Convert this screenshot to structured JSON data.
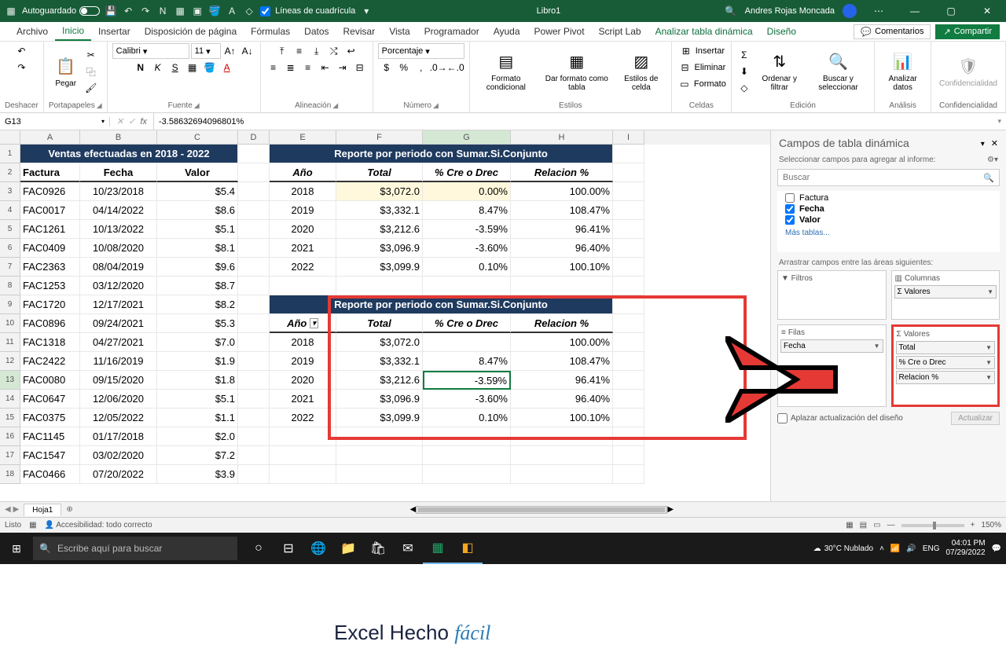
{
  "title": {
    "autosave": "Autoguardado",
    "gridlines": "Líneas de cuadrícula",
    "book": "Libro1",
    "user": "Andres Rojas Moncada"
  },
  "tabs": [
    "Archivo",
    "Inicio",
    "Insertar",
    "Disposición de página",
    "Fórmulas",
    "Datos",
    "Revisar",
    "Vista",
    "Programador",
    "Ayuda",
    "Power Pivot",
    "Script Lab",
    "Analizar tabla dinámica",
    "Diseño"
  ],
  "ribbon": {
    "comments": "Comentarios",
    "share": "Compartir",
    "undo": "Deshacer",
    "clipboard": "Portapapeles",
    "paste": "Pegar",
    "font": "Fuente",
    "font_name": "Calibri",
    "font_size": "11",
    "alignment": "Alineación",
    "number": "Número",
    "number_fmt": "Porcentaje",
    "styles": "Estilos",
    "cond": "Formato condicional",
    "table": "Dar formato como tabla",
    "cellstyles": "Estilos de celda",
    "cells": "Celdas",
    "insert": "Insertar",
    "delete": "Eliminar",
    "format": "Formato",
    "editing": "Edición",
    "sortfilter": "Ordenar y filtrar",
    "find": "Buscar y seleccionar",
    "analysis": "Análisis",
    "analyze": "Analizar datos",
    "sensitivity_label": "Confidencialidad",
    "sensitivity": "Confidencialidad"
  },
  "fbar": {
    "cell": "G13",
    "formula": "-3.58632694096801%"
  },
  "cols": [
    "A",
    "B",
    "C",
    "D",
    "E",
    "F",
    "G",
    "H",
    "I"
  ],
  "ventas": {
    "title": "Ventas efectuadas en 2018 - 2022",
    "hdr": {
      "a": "Factura",
      "b": "Fecha",
      "c": "Valor"
    },
    "rows": [
      [
        "FAC0926",
        "10/23/2018",
        "$5.4"
      ],
      [
        "FAC0017",
        "04/14/2022",
        "$8.6"
      ],
      [
        "FAC1261",
        "10/13/2022",
        "$5.1"
      ],
      [
        "FAC0409",
        "10/08/2020",
        "$8.1"
      ],
      [
        "FAC2363",
        "08/04/2019",
        "$9.6"
      ],
      [
        "FAC1253",
        "03/12/2020",
        "$8.7"
      ],
      [
        "FAC1720",
        "12/17/2021",
        "$8.2"
      ],
      [
        "FAC0896",
        "09/24/2021",
        "$5.3"
      ],
      [
        "FAC1318",
        "04/27/2021",
        "$7.0"
      ],
      [
        "FAC2422",
        "11/16/2019",
        "$1.9"
      ],
      [
        "FAC0080",
        "09/15/2020",
        "$1.8"
      ],
      [
        "FAC0647",
        "12/06/2020",
        "$5.1"
      ],
      [
        "FAC0375",
        "12/05/2022",
        "$1.1"
      ],
      [
        "FAC1145",
        "01/17/2018",
        "$2.0"
      ],
      [
        "FAC1547",
        "03/02/2020",
        "$7.2"
      ],
      [
        "FAC0466",
        "07/20/2022",
        "$3.9"
      ]
    ]
  },
  "report1": {
    "title": "Reporte por periodo con Sumar.Si.Conjunto",
    "hdr": {
      "e": "Año",
      "f": "Total",
      "g": "% Cre o Drec",
      "h": "Relacion %"
    },
    "rows": [
      [
        "2018",
        "$3,072.0",
        "0.00%",
        "100.00%"
      ],
      [
        "2019",
        "$3,332.1",
        "8.47%",
        "108.47%"
      ],
      [
        "2020",
        "$3,212.6",
        "-3.59%",
        "96.41%"
      ],
      [
        "2021",
        "$3,096.9",
        "-3.60%",
        "96.40%"
      ],
      [
        "2022",
        "$3,099.9",
        "0.10%",
        "100.10%"
      ]
    ]
  },
  "report2": {
    "title": "Reporte por periodo con Sumar.Si.Conjunto",
    "hdr": {
      "e": "Año",
      "f": "Total",
      "g": "% Cre o Drec",
      "h": "Relacion %"
    },
    "rows": [
      [
        "2018",
        "$3,072.0",
        "",
        "100.00%"
      ],
      [
        "2019",
        "$3,332.1",
        "8.47%",
        "108.47%"
      ],
      [
        "2020",
        "$3,212.6",
        "-3.59%",
        "96.41%"
      ],
      [
        "2021",
        "$3,096.9",
        "-3.60%",
        "96.40%"
      ],
      [
        "2022",
        "$3,099.9",
        "0.10%",
        "100.10%"
      ]
    ]
  },
  "watermark": {
    "a": "Excel Hecho ",
    "b": "fácil"
  },
  "pane": {
    "title": "Campos de tabla dinámica",
    "sub": "Seleccionar campos para agregar al informe:",
    "search": "Buscar",
    "fields": [
      {
        "n": "Factura",
        "c": false
      },
      {
        "n": "Fecha",
        "c": true
      },
      {
        "n": "Valor",
        "c": true
      }
    ],
    "more": "Más tablas...",
    "drag": "Arrastrar campos entre las áreas siguientes:",
    "columns": "Columnas",
    "rows": "Filas",
    "values": "Valores",
    "col_item": "Σ Valores",
    "row_item": "Fecha",
    "val_items": [
      "Total",
      "% Cre o Drec",
      "Relacion %"
    ],
    "defer": "Aplazar actualización del diseño",
    "update": "Actualizar"
  },
  "sheet": {
    "name": "Hoja1"
  },
  "status": {
    "ready": "Listo",
    "acc": "Accesibilidad: todo correcto",
    "zoom": "150%"
  },
  "taskbar": {
    "search": "Escribe aquí para buscar",
    "weather": "30°C Nublado",
    "lang": "ENG",
    "time": "04:01 PM",
    "date": "07/29/2022"
  }
}
